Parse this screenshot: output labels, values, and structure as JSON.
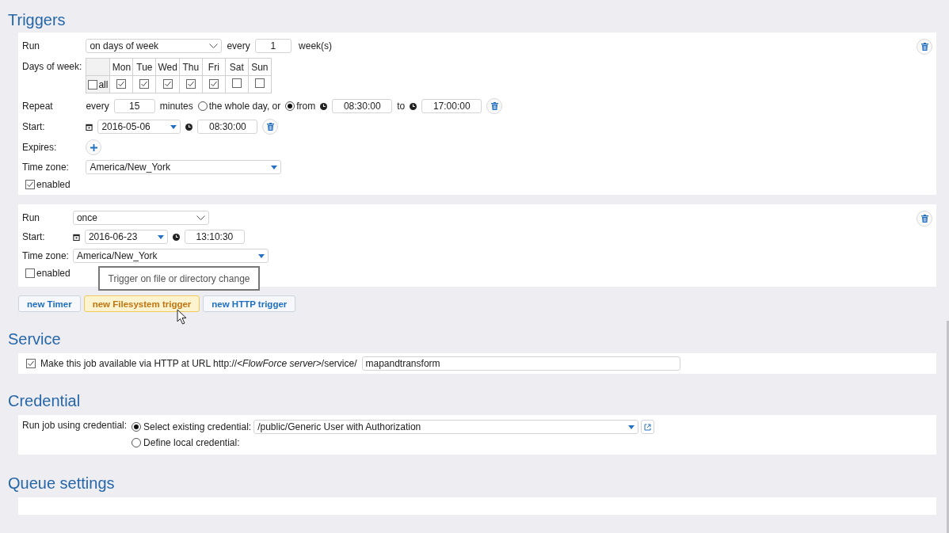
{
  "triggers": {
    "title": "Triggers",
    "timers": [
      {
        "kind": "weekly",
        "run_label": "Run",
        "run": "on days of week",
        "every_label": "every",
        "interval": "1",
        "unit": "week(s)",
        "days_label": "Days of week:",
        "all": {
          "label": "all",
          "checked": false
        },
        "days": [
          {
            "label": "Mon",
            "checked": true
          },
          {
            "label": "Tue",
            "checked": true
          },
          {
            "label": "Wed",
            "checked": true
          },
          {
            "label": "Thu",
            "checked": true
          },
          {
            "label": "Fri",
            "checked": true
          },
          {
            "label": "Sat",
            "checked": false
          },
          {
            "label": "Sun",
            "checked": false
          }
        ],
        "repeat": {
          "label": "Repeat",
          "every_label": "every",
          "value": "15",
          "unit": "minutes",
          "options": [
            {
              "label": "the whole day, or",
              "selected": false
            },
            {
              "label": "from",
              "selected": true
            }
          ],
          "from": "08:30:00",
          "to_label": "to",
          "to": "17:00:00"
        },
        "start_label": "Start:",
        "start_date": "2016-05-06",
        "start_time": "08:30:00",
        "expires_label": "Expires:",
        "timezone_label": "Time zone:",
        "timezone": "America/New_York",
        "enabled": {
          "label": "enabled",
          "checked": true
        }
      },
      {
        "kind": "once",
        "run_label": "Run",
        "run": "once",
        "start_label": "Start:",
        "start_date": "2016-06-23",
        "start_time": "13:10:30",
        "timezone_label": "Time zone:",
        "timezone": "America/New_York",
        "enabled": {
          "label": "enabled",
          "checked": false
        }
      }
    ],
    "tooltip": "Trigger on file or directory change",
    "buttons": [
      {
        "label": "new Timer",
        "hovered": false
      },
      {
        "label": "new Filesystem trigger",
        "hovered": true
      },
      {
        "label": "new HTTP trigger",
        "hovered": false
      }
    ]
  },
  "service": {
    "title": "Service",
    "checked": true,
    "text": "Make this job available via HTTP at URL http://*<FlowForce server>*/service/",
    "value": "mapandtransform"
  },
  "credential": {
    "title": "Credential",
    "label": "Run job using credential:",
    "options": [
      {
        "label": "Select existing credential:",
        "selected": true
      },
      {
        "label": "Define local credential:",
        "selected": false
      }
    ],
    "value": "/public/Generic User with Authorization"
  },
  "queue": {
    "title": "Queue settings"
  }
}
